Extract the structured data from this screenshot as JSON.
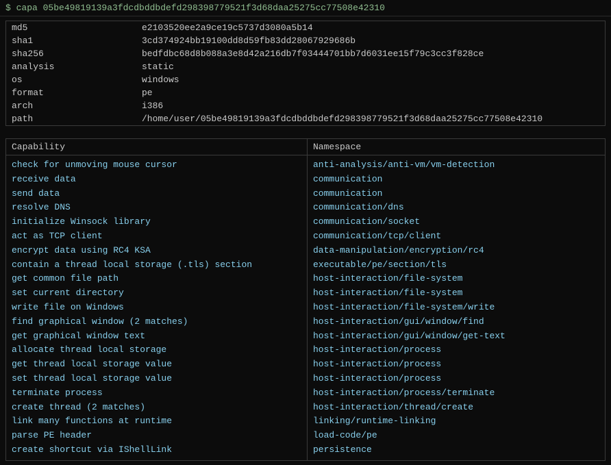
{
  "titleBar": {
    "prefix": "$ capa ",
    "hash": "05be49819139a3fdcdbddbdefd298398779521f3d68daa25275cc77508e42310"
  },
  "metadata": {
    "rows": [
      {
        "key": "md5",
        "value": "e2103520ee2a9ce19c5737d3080a5b14"
      },
      {
        "key": "sha1",
        "value": "3cd374924bb19100dd8d59fb83dd28067929686b"
      },
      {
        "key": "sha256",
        "value": "bedfdbc68d8b088a3e8d42a216db7f03444701bb7d6031ee15f79c3cc3f828ce"
      },
      {
        "key": "analysis",
        "value": "static"
      },
      {
        "key": "os",
        "value": "windows"
      },
      {
        "key": "format",
        "value": "pe"
      },
      {
        "key": "arch",
        "value": "i386"
      },
      {
        "key": "path",
        "value": "/home/user/05be49819139a3fdcdbddbdefd298398779521f3d68daa25275cc77508e42310"
      }
    ]
  },
  "capabilities": {
    "colCapability": "Capability",
    "colNamespace": "Namespace",
    "rows": [
      {
        "capability": "check for unmoving mouse cursor",
        "namespace": "anti-analysis/anti-vm/vm-detection"
      },
      {
        "capability": "receive data",
        "namespace": "communication"
      },
      {
        "capability": "send data",
        "namespace": "communication"
      },
      {
        "capability": "resolve DNS",
        "namespace": "communication/dns"
      },
      {
        "capability": "initialize Winsock library",
        "namespace": "communication/socket"
      },
      {
        "capability": "act as TCP client",
        "namespace": "communication/tcp/client"
      },
      {
        "capability": "encrypt data using RC4 KSA",
        "namespace": "data-manipulation/encryption/rc4"
      },
      {
        "capability": "contain a thread local storage (.tls) section",
        "namespace": "executable/pe/section/tls"
      },
      {
        "capability": "get common file path",
        "namespace": "host-interaction/file-system"
      },
      {
        "capability": "set current directory",
        "namespace": "host-interaction/file-system"
      },
      {
        "capability": "write file on Windows",
        "namespace": "host-interaction/file-system/write"
      },
      {
        "capability": "find graphical window (2 matches)",
        "namespace": "host-interaction/gui/window/find"
      },
      {
        "capability": "get graphical window text",
        "namespace": "host-interaction/gui/window/get-text"
      },
      {
        "capability": "allocate thread local storage",
        "namespace": "host-interaction/process"
      },
      {
        "capability": "get thread local storage value",
        "namespace": "host-interaction/process"
      },
      {
        "capability": "set thread local storage value",
        "namespace": "host-interaction/process"
      },
      {
        "capability": "terminate process",
        "namespace": "host-interaction/process/terminate"
      },
      {
        "capability": "create thread (2 matches)",
        "namespace": "host-interaction/thread/create"
      },
      {
        "capability": "link many functions at runtime",
        "namespace": "linking/runtime-linking"
      },
      {
        "capability": "parse PE header",
        "namespace": "load-code/pe"
      },
      {
        "capability": "create shortcut via IShellLink",
        "namespace": "persistence"
      }
    ]
  }
}
